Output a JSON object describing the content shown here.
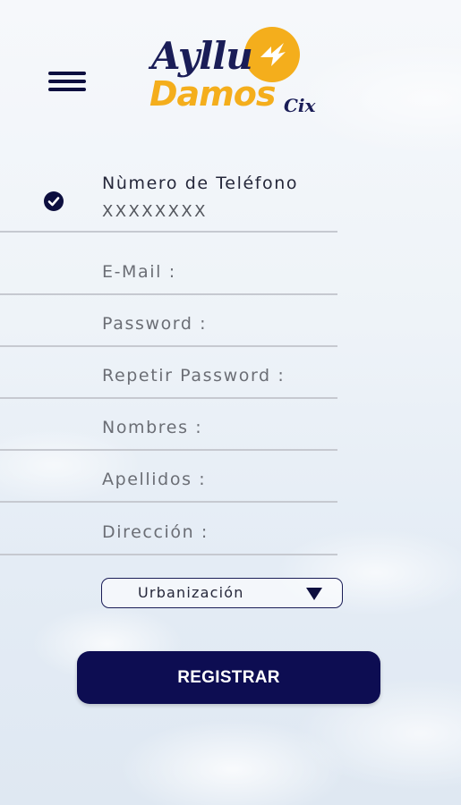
{
  "header": {
    "menu_icon": "hamburger-menu-icon",
    "logo": {
      "line1": "Ayllu",
      "line2": "Damos",
      "suffix": "Cix",
      "colors": {
        "navy": "#1a1d57",
        "gold": "#f4ae1c"
      }
    }
  },
  "form": {
    "phone": {
      "label": "Nùmero de Teléfono",
      "value": "XXXXXXXX",
      "status_icon": "check-circle-icon"
    },
    "fields": [
      {
        "label": "E-Mail :"
      },
      {
        "label": "Password :"
      },
      {
        "label": "Repetir Password :"
      },
      {
        "label": "Nombres :"
      },
      {
        "label": "Apellidos :"
      },
      {
        "label": "Dirección :"
      }
    ],
    "urbanizacion": {
      "selected": "Urbanización",
      "icon": "dropdown-triangle-icon"
    },
    "submit_label": "REGISTRAR"
  },
  "colors": {
    "primary": "#0d0d52",
    "label": "#6b6e75",
    "divider": "#c6c9d0"
  }
}
